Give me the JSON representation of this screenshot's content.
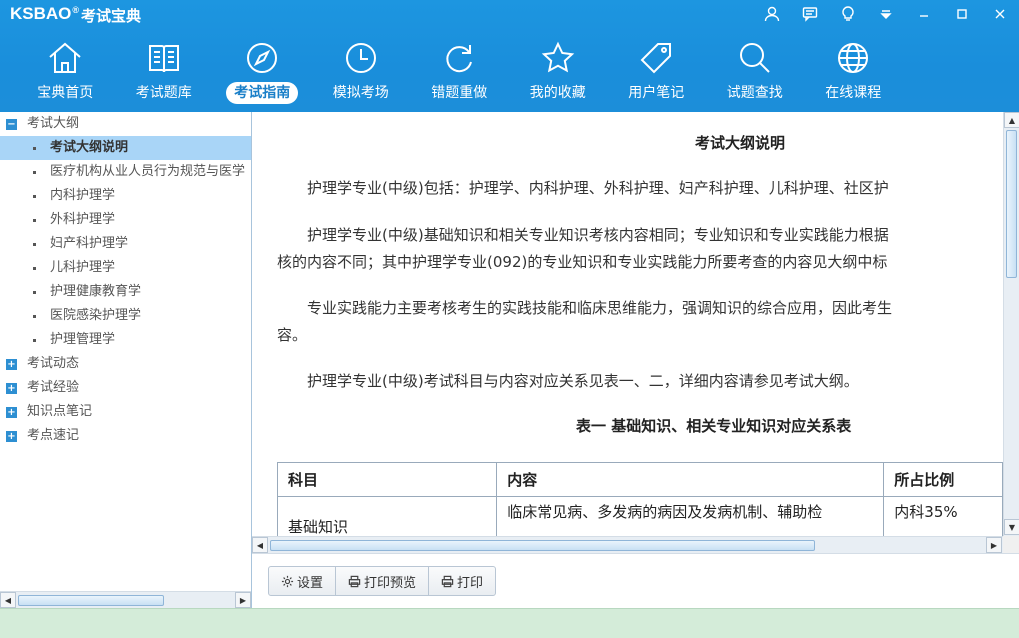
{
  "app": {
    "brand": "KSBAO",
    "brand_reg": "®",
    "brand_cn": "考试宝典"
  },
  "window_controls": [
    "user-icon",
    "message-icon",
    "bulb-icon",
    "dropdown-icon",
    "minimize-icon",
    "maximize-icon",
    "close-icon"
  ],
  "nav": [
    {
      "label": "宝典首页",
      "icon": "home-icon"
    },
    {
      "label": "考试题库",
      "icon": "book-icon"
    },
    {
      "label": "考试指南",
      "icon": "compass-icon",
      "active": true
    },
    {
      "label": "模拟考场",
      "icon": "clock-icon"
    },
    {
      "label": "错题重做",
      "icon": "refresh-icon"
    },
    {
      "label": "我的收藏",
      "icon": "star-icon"
    },
    {
      "label": "用户笔记",
      "icon": "tag-icon"
    },
    {
      "label": "试题查找",
      "icon": "search-icon"
    },
    {
      "label": "在线课程",
      "icon": "globe-icon"
    }
  ],
  "tree": {
    "root_expanded": {
      "label": "考试大纲",
      "sign": "−"
    },
    "children": [
      "考试大纲说明",
      "医疗机构从业人员行为规范与医学",
      "内科护理学",
      "外科护理学",
      "妇产科护理学",
      "儿科护理学",
      "护理健康教育学",
      "医院感染护理学",
      "护理管理学"
    ],
    "collapsed": [
      {
        "label": "考试动态",
        "sign": "+"
      },
      {
        "label": "考试经验",
        "sign": "+"
      },
      {
        "label": "知识点笔记",
        "sign": "+"
      },
      {
        "label": "考点速记",
        "sign": "+"
      }
    ]
  },
  "doc": {
    "title": "考试大纲说明",
    "paragraphs": [
      "　　护理学专业(中级)包括：护理学、内科护理、外科护理、妇产科护理、儿科护理、社区护",
      "　　护理学专业(中级)基础知识和相关专业知识考核内容相同；专业知识和专业实践能力根据",
      "核的内容不同；其中护理学专业(092)的专业知识和专业实践能力所要考查的内容见大纲中标",
      "　　专业实践能力主要考核考生的实践技能和临床思维能力，强调知识的综合应用，因此考生",
      "容。",
      "　　护理学专业(中级)考试科目与内容对应关系见表一、二，详细内容请参见考试大纲。"
    ],
    "table_title": "表一  基础知识、相关专业知识对应关系表",
    "table": {
      "headers": [
        "科目",
        "内容",
        "所占比例"
      ],
      "row1": [
        "基础知识",
        "临床常见病、多发病的病因及发病机制、辅助检",
        "内科35%"
      ]
    }
  },
  "toolbar": {
    "settings": "设置",
    "print_preview": "打印预览",
    "print": "打印"
  }
}
